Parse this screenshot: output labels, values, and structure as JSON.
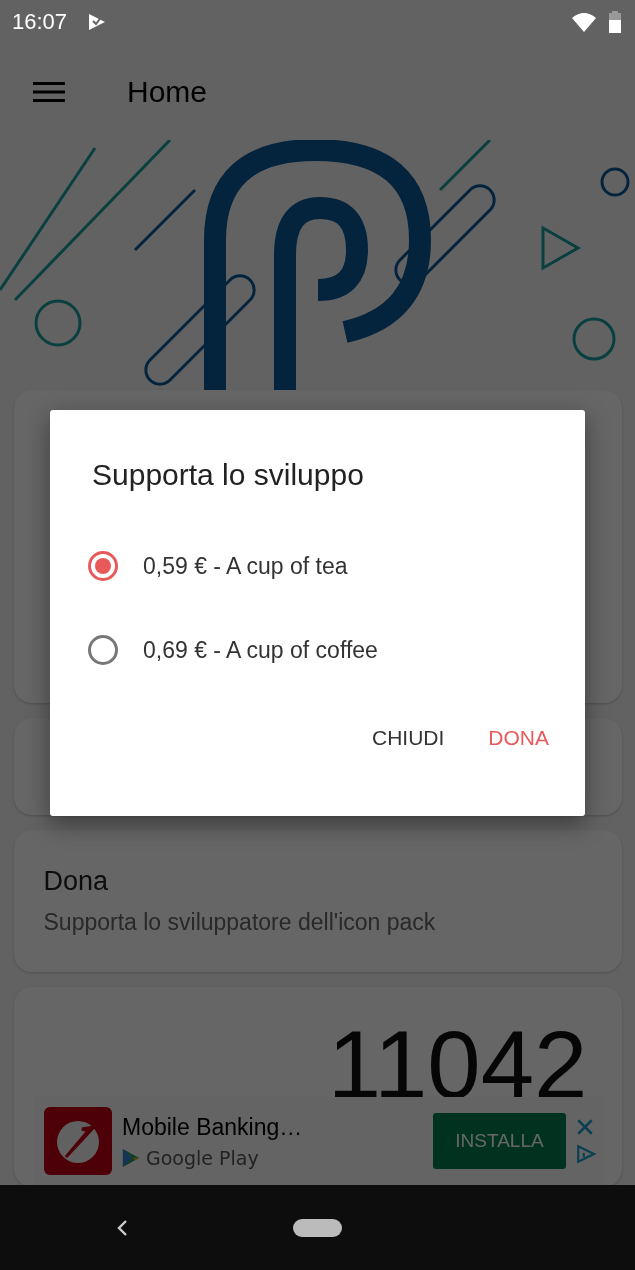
{
  "status_bar": {
    "time": "16:07"
  },
  "app_bar": {
    "title": "Home"
  },
  "cards": [
    {
      "kind": "blank"
    },
    {
      "kind": "blank"
    },
    {
      "kind": "text",
      "title": "Dona",
      "subtitle": "Supporta lo sviluppatore dell'icon pack"
    },
    {
      "kind": "counter",
      "value": "11042"
    }
  ],
  "dialog": {
    "title": "Supporta lo sviluppo",
    "options": [
      {
        "label": "0,59 € - A cup of tea",
        "selected": true
      },
      {
        "label": "0,69 € - A cup of coffee",
        "selected": false
      }
    ],
    "buttons": [
      {
        "label": "CHIUDI",
        "kind": "neutral"
      },
      {
        "label": "DONA",
        "kind": "primary"
      }
    ]
  },
  "ad": {
    "title": "Mobile Banking…",
    "store": "Google Play",
    "button": "INSTALLA"
  }
}
